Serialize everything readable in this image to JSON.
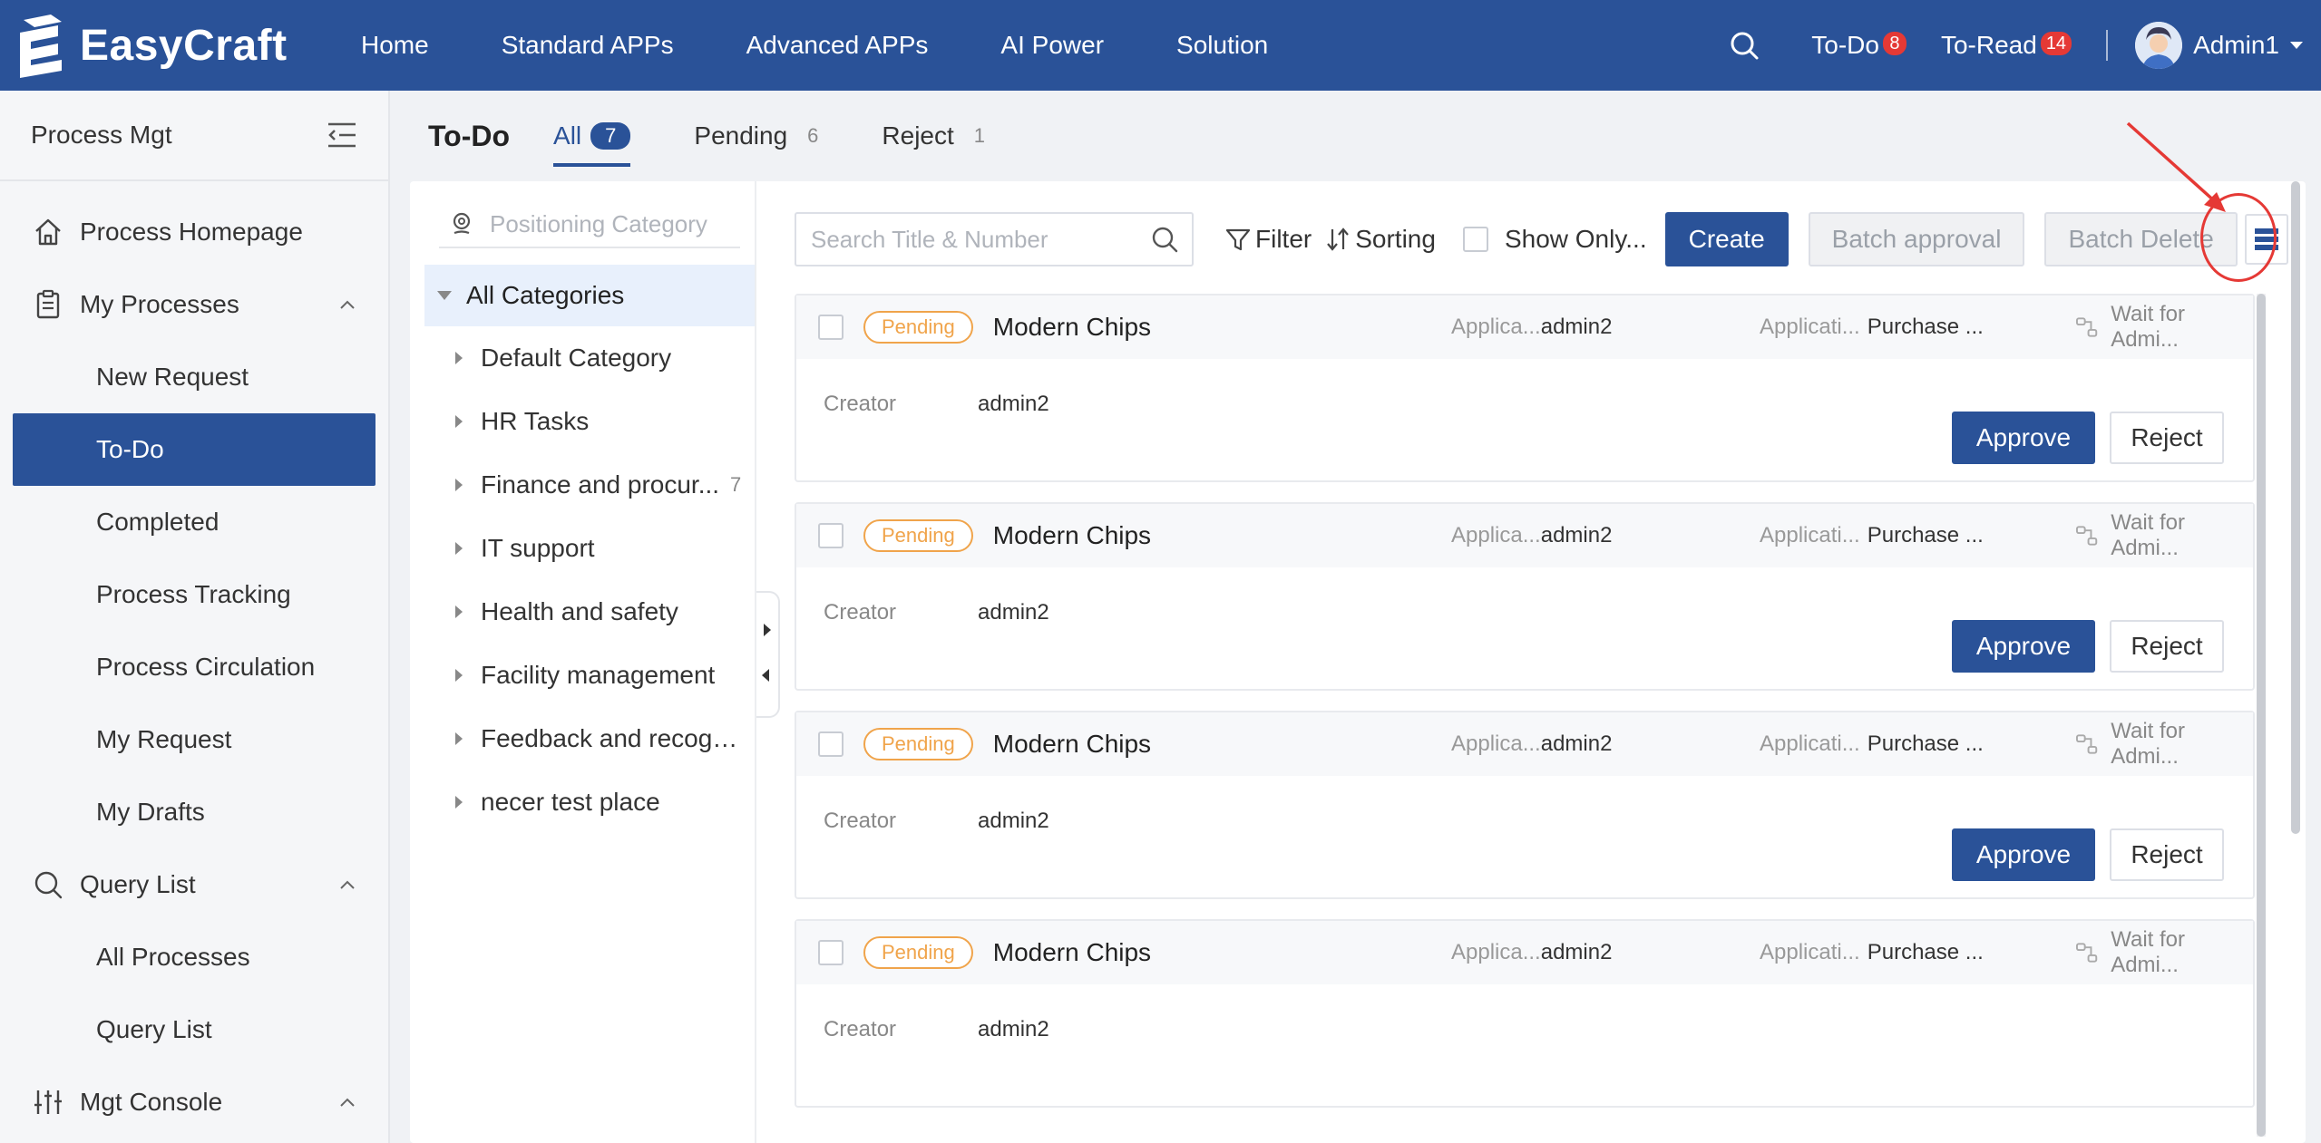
{
  "app": {
    "name": "EasyCraft"
  },
  "topnav": {
    "items": [
      "Home",
      "Standard APPs",
      "Advanced APPs",
      "AI Power",
      "Solution"
    ],
    "todo_label": "To-Do",
    "todo_count": "8",
    "toread_label": "To-Read",
    "toread_count": "14",
    "user_name": "Admin1"
  },
  "sidebar": {
    "title": "Process Mgt",
    "home": "Process Homepage",
    "my_processes": "My Processes",
    "my_processes_items": [
      "New Request",
      "To-Do",
      "Completed",
      "Process Tracking",
      "Process Circulation",
      "My Request",
      "My Drafts"
    ],
    "query_list": "Query List",
    "query_items": [
      "All Processes",
      "Query List"
    ],
    "mgt_console": "Mgt Console",
    "active_item": "To-Do"
  },
  "page": {
    "title": "To-Do",
    "tabs": [
      {
        "label": "All",
        "count": "7"
      },
      {
        "label": "Pending",
        "count": "6"
      },
      {
        "label": "Reject",
        "count": "1"
      }
    ]
  },
  "categories": {
    "search_placeholder": "Positioning Category",
    "all_label": "All Categories",
    "items": [
      {
        "name": "Default Category",
        "count": ""
      },
      {
        "name": "HR Tasks",
        "count": ""
      },
      {
        "name": "Finance and procur...",
        "count": "7"
      },
      {
        "name": "IT support",
        "count": ""
      },
      {
        "name": "Health and safety",
        "count": ""
      },
      {
        "name": "Facility management",
        "count": ""
      },
      {
        "name": "Feedback and recogni...",
        "count": ""
      },
      {
        "name": "necer test place",
        "count": ""
      }
    ]
  },
  "toolbar": {
    "search_placeholder": "Search Title & Number",
    "filter_label": "Filter",
    "sorting_label": "Sorting",
    "show_only_label": "Show Only...",
    "create_label": "Create",
    "batch_approval_label": "Batch approval",
    "batch_delete_label": "Batch Delete"
  },
  "tasks": [
    {
      "status": "Pending",
      "title": "Modern Chips",
      "applicant_label": "Applica...",
      "applicant": "admin2",
      "app_label": "Applicati...",
      "app_value": "Purchase ...",
      "node": "Wait for Admi...",
      "creator_label": "Creator",
      "creator": "admin2",
      "approve": "Approve",
      "reject": "Reject"
    },
    {
      "status": "Pending",
      "title": "Modern Chips",
      "applicant_label": "Applica...",
      "applicant": "admin2",
      "app_label": "Applicati...",
      "app_value": "Purchase ...",
      "node": "Wait for Admi...",
      "creator_label": "Creator",
      "creator": "admin2",
      "approve": "Approve",
      "reject": "Reject"
    },
    {
      "status": "Pending",
      "title": "Modern Chips",
      "applicant_label": "Applica...",
      "applicant": "admin2",
      "app_label": "Applicati...",
      "app_value": "Purchase ...",
      "node": "Wait for Admi...",
      "creator_label": "Creator",
      "creator": "admin2",
      "approve": "Approve",
      "reject": "Reject"
    },
    {
      "status": "Pending",
      "title": "Modern Chips",
      "applicant_label": "Applica...",
      "applicant": "admin2",
      "app_label": "Applicati...",
      "app_value": "Purchase ...",
      "node": "Wait for Admi...",
      "creator_label": "Creator",
      "creator": "admin2",
      "approve": "",
      "reject": ""
    }
  ],
  "colors": {
    "brand": "#2a5298",
    "pending": "#f0a44b",
    "badge": "#e53935",
    "annotation": "#e53935"
  }
}
